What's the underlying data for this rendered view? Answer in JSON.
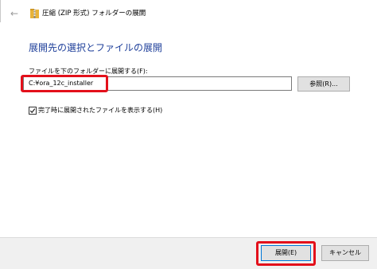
{
  "window": {
    "back_icon": "arrow-left-icon",
    "folder_icon": "zip-folder-icon",
    "title": "圧縮 (ZIP 形式) フォルダーの展開"
  },
  "main": {
    "heading": "展開先の選択とファイルの展開",
    "destination_label": "ファイルを下のフォルダーに展開する(F):",
    "destination_value": "C:¥ora_12c_installer",
    "browse_label": "参照(R)...",
    "show_files_checked": true,
    "show_files_label": "完了時に展開されたファイルを表示する(H)"
  },
  "footer": {
    "extract_label": "展開(E)",
    "cancel_label": "キャンセル"
  },
  "colors": {
    "heading": "#1e3f9a",
    "highlight": "#e3101b",
    "folder_yellow": "#e8b33a"
  }
}
